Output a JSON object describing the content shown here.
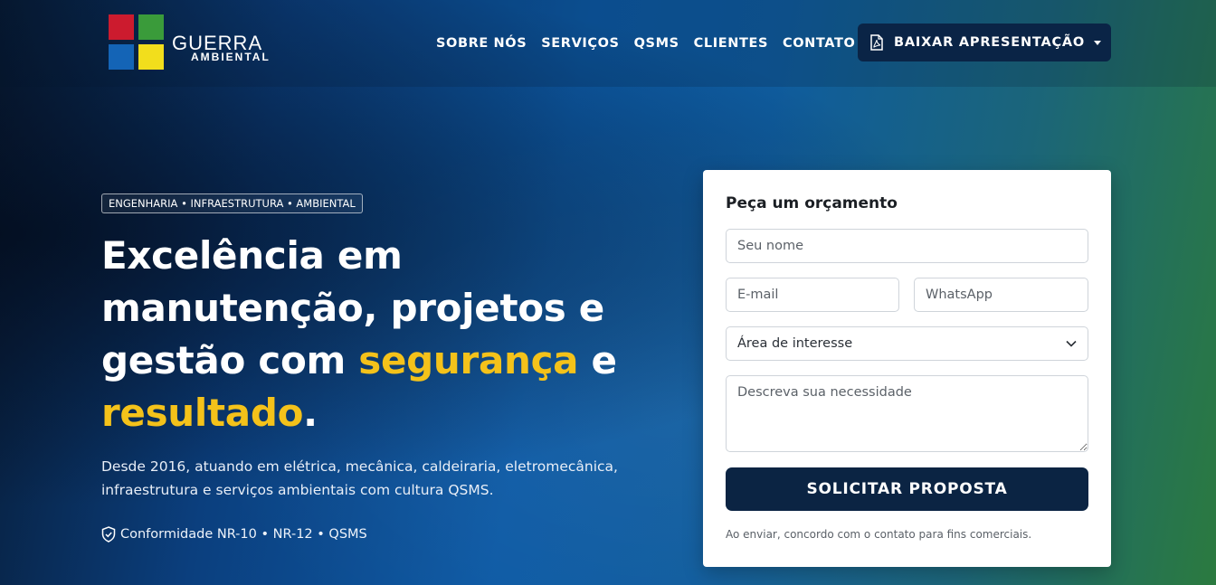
{
  "brand": {
    "name_line1": "GUERRA",
    "name_line2": "AMBIENTAL",
    "colors": [
      "#cc1b2e",
      "#3a9b3a",
      "#1464b6",
      "#f2de1c"
    ]
  },
  "nav": {
    "items": [
      "SOBRE NÓS",
      "SERVIÇOS",
      "QSMS",
      "CLIENTES",
      "CONTATO"
    ],
    "download_label": "BAIXAR APRESENTAÇÃO",
    "download_icon": "pdf-file-icon"
  },
  "hero": {
    "tagline": "ENGENHARIA • INFRAESTRUTURA • AMBIENTAL",
    "headline_part1": "Excelência em manutenção, projetos e gestão com ",
    "headline_hl1": "segurança",
    "headline_part2": " e ",
    "headline_hl2": "resultado",
    "headline_end": ".",
    "subtitle": "Desde 2016, atuando em elétrica, mecânica, caldeiraria, eletromecânica, infraestrutura e serviços ambientais com cultura QSMS.",
    "compliance": "Conformidade NR-10 • NR-12 • QSMS",
    "highlight_color": "#f4c21a"
  },
  "form": {
    "title": "Peça um orçamento",
    "name_placeholder": "Seu nome",
    "email_placeholder": "E-mail",
    "whatsapp_placeholder": "WhatsApp",
    "interest_selected": "Área de interesse",
    "message_placeholder": "Descreva sua necessidade",
    "submit_label": "SOLICITAR PROPOSTA",
    "note": "Ao enviar, concordo com o contato para fins comerciais."
  }
}
